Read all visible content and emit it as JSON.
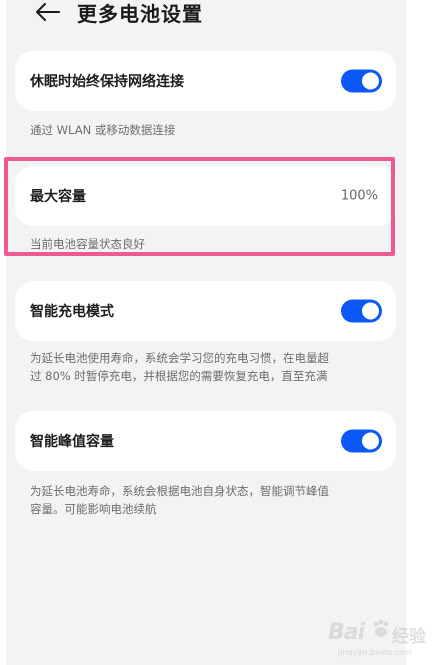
{
  "header": {
    "title": "更多电池设置"
  },
  "settings": [
    {
      "title": "休眠时始终保持网络连接",
      "toggle_on": true,
      "description": [
        "通过 WLAN 或移动数据连接"
      ]
    },
    {
      "title": "最大容量",
      "value": "100%",
      "description": [
        "当前电池容量状态良好"
      ]
    },
    {
      "title": "智能充电模式",
      "toggle_on": true,
      "description": [
        "为延长电池使用寿命，系统会学习您的充电习惯，在电量超",
        "过 80% 时暂停充电，并根据您的需要恢复充电，直至充满"
      ]
    },
    {
      "title": "智能峰值容量",
      "toggle_on": true,
      "description": [
        "为延长电池寿命，系统会根据电池自身状态，智能调节峰值",
        "容量。可能影响电池续航"
      ]
    }
  ],
  "watermark": {
    "text_main": "Bai",
    "text_right": "经验",
    "text_sub": "jingyan.baidu.com"
  },
  "colors": {
    "accent": "#0a59f7",
    "highlight_border": "#f05a92",
    "background": "#f1f3f5"
  }
}
